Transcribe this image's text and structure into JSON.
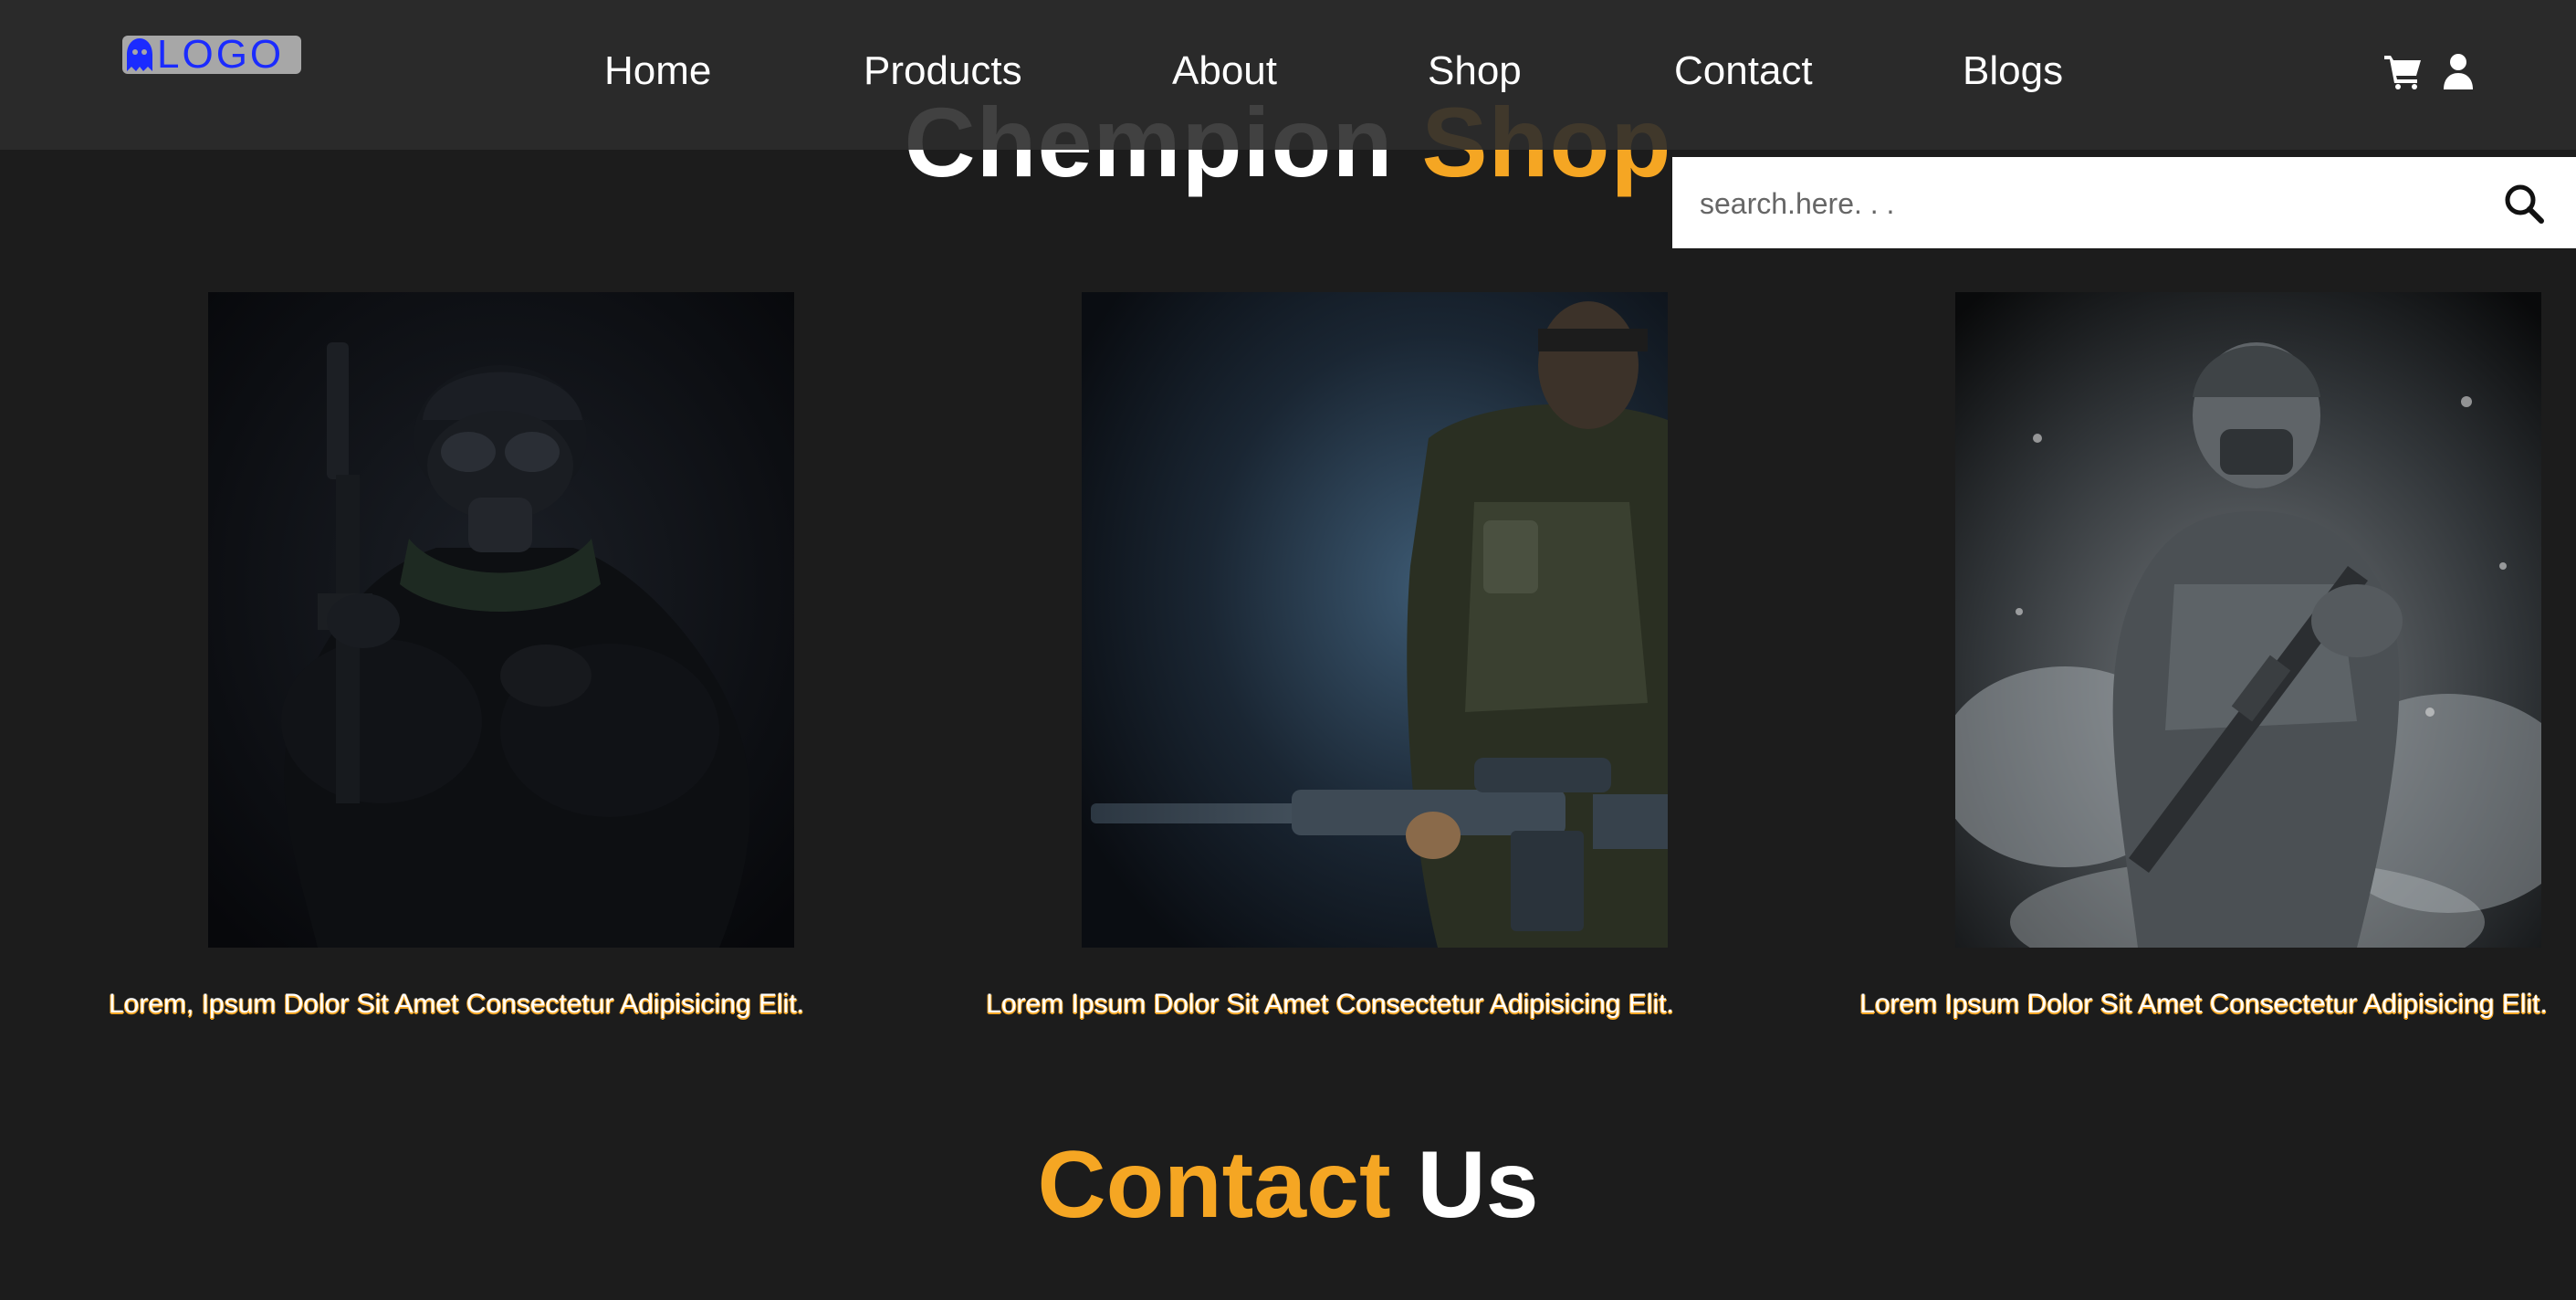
{
  "navbar": {
    "logo_text": "LOGO",
    "links": [
      "Home",
      "Products",
      "About",
      "Shop",
      "Contact",
      "Blogs"
    ],
    "cart_icon": "cart-icon",
    "user_icon": "user-icon"
  },
  "shop_section": {
    "title_part1": "Chempion",
    "title_part2": "Shop",
    "search": {
      "placeholder": "search.here. . ."
    },
    "cards": [
      {
        "caption": "Lorem, Ipsum Dolor Sit Amet Consectetur Adipisicing Elit."
      },
      {
        "caption": "Lorem Ipsum Dolor Sit Amet Consectetur Adipisicing Elit."
      },
      {
        "caption": "Lorem Ipsum Dolor Sit Amet Consectetur Adipisicing Elit."
      }
    ]
  },
  "contact_section": {
    "title_part1": "Contact",
    "title_part2": "Us"
  },
  "colors": {
    "background": "#1c1c1c",
    "navbar": "#2c2c2c",
    "accent": "#f5a623",
    "logo_text": "#1b2bff"
  }
}
